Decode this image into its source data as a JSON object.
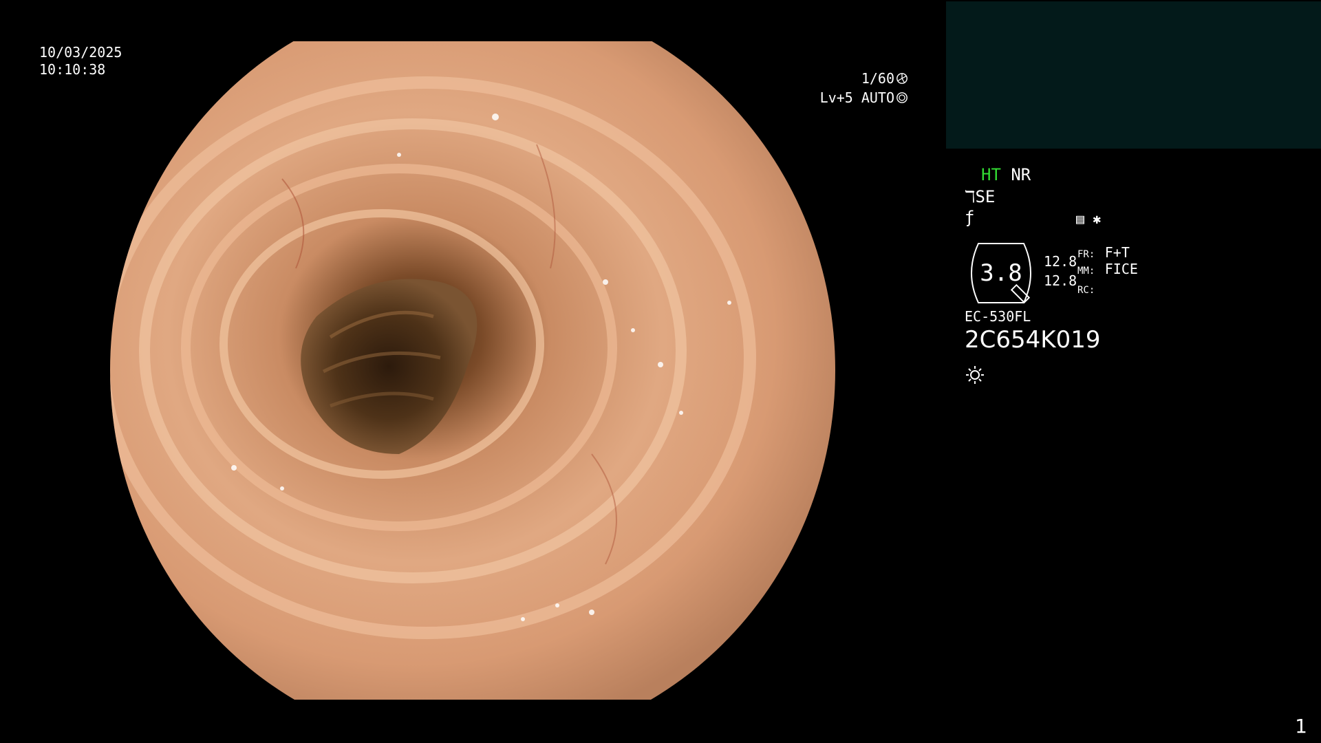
{
  "date": "10/03/2025",
  "time": "10:10:38",
  "top_info": {
    "shutter": "1/60",
    "level": "Lv+5",
    "iris_mode": "AUTO"
  },
  "side_panel": {
    "ht_label": "HT",
    "nr_label": "NR",
    "se_label": "SE",
    "zoom_value": "3.8",
    "val_a": "12.8",
    "val_b": "12.8",
    "fr_label": "FR:",
    "fr_value": "F+T",
    "mm_label": "MM:",
    "mm_value": "FICE",
    "rc_label": "RC:",
    "scope_model": "EC-530FL",
    "scope_serial": "2C654K019"
  },
  "page_number": "1",
  "icons": [
    "shutter-icon",
    "iris-icon",
    "se-icon",
    "f-icon",
    "memo-icon",
    "asterisk-icon",
    "zoom-dial-icon",
    "light-icon"
  ]
}
